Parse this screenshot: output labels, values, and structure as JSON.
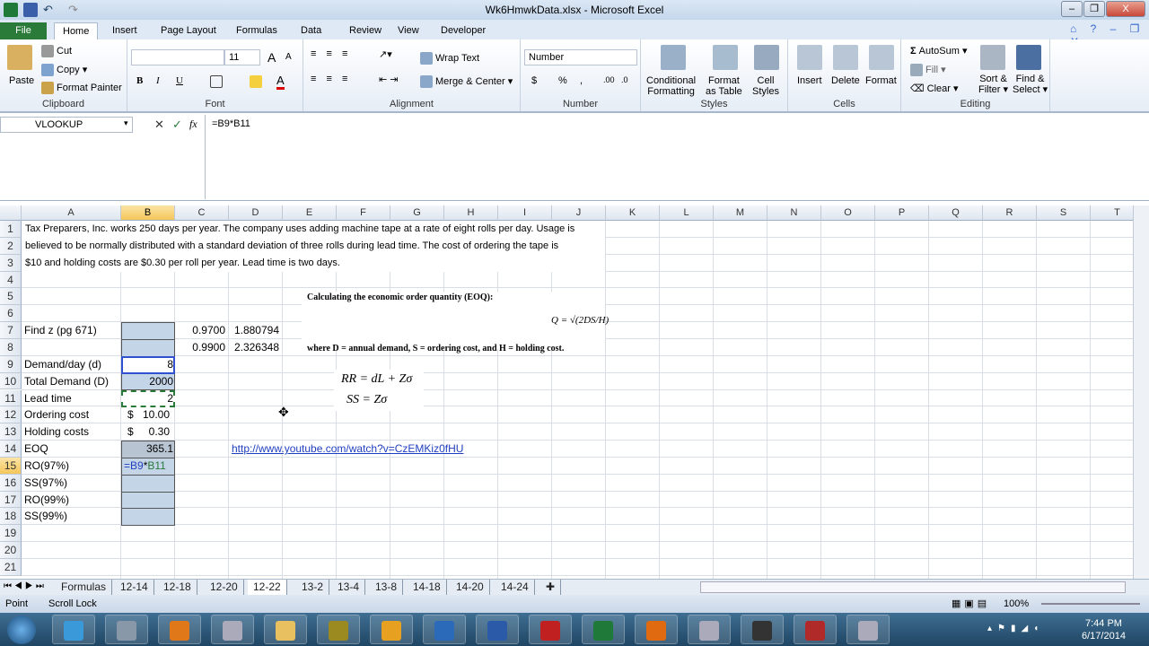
{
  "window": {
    "title": "Wk6HmwkData.xlsx - Microsoft Excel",
    "minimize": "–",
    "restore": "❐",
    "close": "X"
  },
  "ribbon_tabs": [
    "File",
    "Home",
    "Insert",
    "Page Layout",
    "Formulas",
    "Data",
    "Review",
    "View",
    "Developer"
  ],
  "active_tab": "Home",
  "clipboard": {
    "paste": "Paste",
    "cut": "Cut",
    "copy": "Copy",
    "format_painter": "Format Painter",
    "label": "Clipboard"
  },
  "font": {
    "name": "",
    "size": "11",
    "label": "Font",
    "bold": "B",
    "italic": "I",
    "underline": "U",
    "grow": "A",
    "shrink": "A",
    "color": "A"
  },
  "alignment": {
    "wrap": "Wrap Text",
    "merge": "Merge & Center",
    "label": "Alignment"
  },
  "number": {
    "format": "Number",
    "currency": "$",
    "percent": "%",
    "comma": ",",
    "inc": ".00",
    "dec": ".0",
    "label": "Number"
  },
  "styles": {
    "conditional": "Conditional",
    "conditional2": "Formatting",
    "format_table": "Format",
    "format_table2": "as Table",
    "cell_styles": "Cell",
    "cell_styles2": "Styles",
    "label": "Styles"
  },
  "cells": {
    "insert": "Insert",
    "delete": "Delete",
    "format": "Format",
    "label": "Cells"
  },
  "editing": {
    "autosum": "AutoSum",
    "fill": "Fill",
    "clear": "Clear",
    "sort": "Sort &",
    "sort2": "Filter",
    "find": "Find &",
    "find2": "Select",
    "label": "Editing"
  },
  "formula_bar": {
    "name_box": "VLOOKUP",
    "fx": "fx",
    "cancel": "✕",
    "enter": "✓",
    "formula": "=B9*B11"
  },
  "columns": [
    "A",
    "B",
    "C",
    "D",
    "E",
    "F",
    "G",
    "H",
    "I",
    "J",
    "K",
    "L",
    "M",
    "N",
    "O",
    "P",
    "Q",
    "R",
    "S",
    "T"
  ],
  "selected_column": "B",
  "selected_row": 15,
  "rows": [
    1,
    2,
    3,
    4,
    5,
    6,
    7,
    8,
    9,
    10,
    11,
    12,
    13,
    14,
    15,
    16,
    17,
    18,
    19,
    20,
    21
  ],
  "sheet": {
    "intro": [
      "Tax Preparers, Inc. works 250 days per year. The company uses adding machine tape at a rate of eight rolls per day.  Usage is",
      "believed to be normally distributed with a standard deviation of three rolls during lead time. The cost of ordering the tape is",
      "$10 and holding costs are $0.30 per roll per year. Lead time is two days."
    ],
    "labels": {
      "7": "Find z (pg 671)",
      "9": "Demand/day (d)",
      "10": "Total Demand (D)",
      "11": "Lead time",
      "12": "Ordering cost",
      "13": "Holding costs",
      "14": "EOQ",
      "15": "RO(97%)",
      "16": "SS(97%)",
      "17": "RO(99%)",
      "18": "SS(99%)"
    },
    "b": {
      "9": "8",
      "10": "2000",
      "11": "2",
      "12_sym": "$",
      "12": "10.00",
      "13_sym": "$",
      "13": "0.30",
      "14": "365.1",
      "15": "=B9*B11"
    },
    "c7": "0.9700",
    "d7": "1.880794",
    "c8": "0.9900",
    "d8": "2.326348",
    "eoq_title": "Calculating the economic order quantity (EOQ):",
    "eoq_formula": "Q = √(2DS/H)",
    "eoq_where": "where D = annual demand, S = ordering cost, and H = holding cost.",
    "rr_formula": "RR = dL + Zσ",
    "ss_formula": "SS = Zσ",
    "link": "http://www.youtube.com/watch?v=CzEMKiz0fHU"
  },
  "sheet_tabs": [
    "Formulas",
    "12-14",
    "12-18",
    "12-20",
    "12-22",
    "13-2",
    "13-4",
    "13-8",
    "14-18",
    "14-20",
    "14-24"
  ],
  "active_sheet": "12-22",
  "status": {
    "mode": "Point",
    "scroll_lock": "Scroll Lock",
    "zoom": "100%"
  },
  "taskbar": {
    "time": "7:44 PM",
    "date": "6/17/2014",
    "apps": [
      "ie",
      "tools",
      "media",
      "calculator",
      "explorer",
      "security",
      "outlook",
      "lync",
      "word",
      "acrobat",
      "excel",
      "firefox",
      "notes",
      "som",
      "access",
      "notes2"
    ]
  },
  "colors": {
    "file_tab": "#2a7a3a",
    "selection_fill": "#c5d5e8",
    "link": "#1f3fbf",
    "formula_ref_blue": "#1f3fbf",
    "formula_ref_green": "#2a7a3a"
  }
}
